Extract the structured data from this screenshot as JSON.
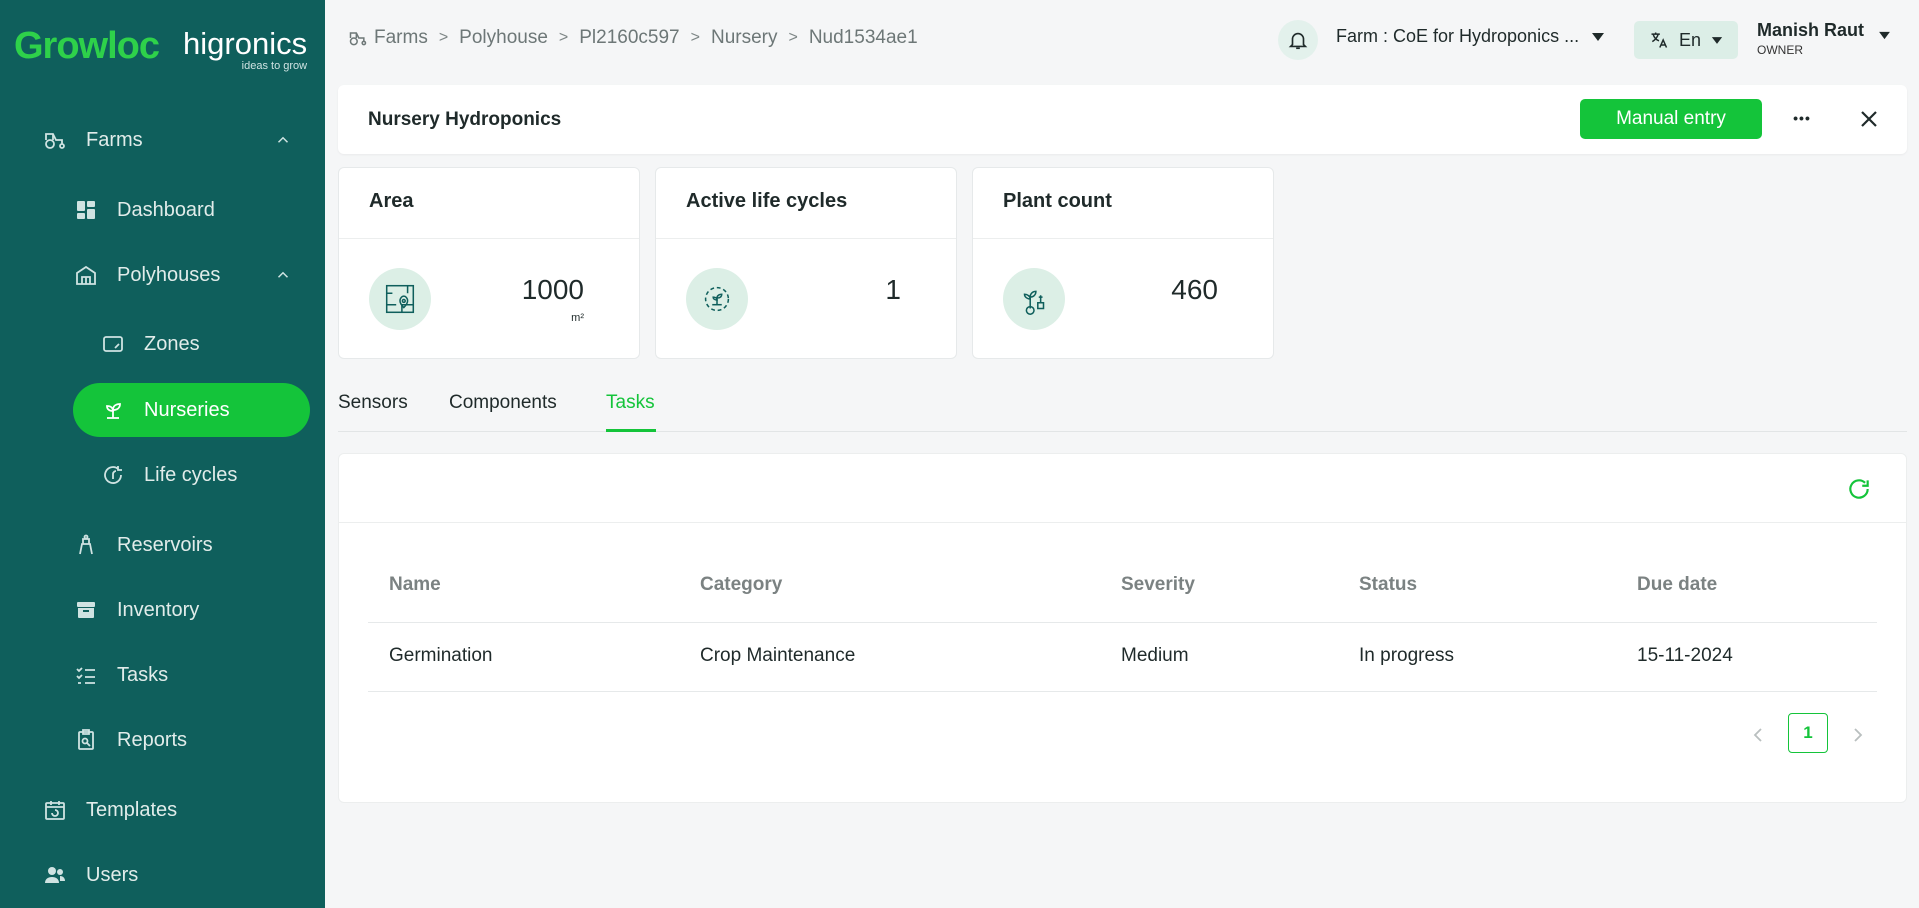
{
  "brand": {
    "logo": "Growloc",
    "partner": "higronics",
    "tagline": "ideas to grow"
  },
  "sidebar": {
    "items": [
      {
        "label": "Farms",
        "icon": "tractor-icon"
      },
      {
        "label": "Dashboard",
        "icon": "dashboard-icon"
      },
      {
        "label": "Polyhouses",
        "icon": "polyhouse-icon"
      },
      {
        "label": "Zones",
        "icon": "zone-icon"
      },
      {
        "label": "Nurseries",
        "icon": "sprout-icon"
      },
      {
        "label": "Life cycles",
        "icon": "cycle-icon"
      },
      {
        "label": "Reservoirs",
        "icon": "reservoir-icon"
      },
      {
        "label": "Inventory",
        "icon": "inventory-icon"
      },
      {
        "label": "Tasks",
        "icon": "tasks-icon"
      },
      {
        "label": "Reports",
        "icon": "reports-icon"
      },
      {
        "label": "Templates",
        "icon": "templates-icon"
      },
      {
        "label": "Users",
        "icon": "users-icon"
      }
    ],
    "active": "Nurseries"
  },
  "breadcrumb": [
    "Farms",
    "Polyhouse",
    "Pl2160c597",
    "Nursery",
    "Nud1534ae1"
  ],
  "topbar": {
    "farm_label": "Farm : CoE for Hydroponics ...",
    "language": "En",
    "user_name": "Manish Raut",
    "user_role": "OWNER"
  },
  "header": {
    "title": "Nursery Hydroponics",
    "manual_entry_label": "Manual entry",
    "more_label": "•••"
  },
  "stats": {
    "area": {
      "title": "Area",
      "value": "1000",
      "unit": "m²"
    },
    "active_life_cycles": {
      "title": "Active life cycles",
      "value": "1"
    },
    "plant_count": {
      "title": "Plant count",
      "value": "460"
    }
  },
  "tabs": [
    {
      "label": "Sensors"
    },
    {
      "label": "Components"
    },
    {
      "label": "Tasks"
    }
  ],
  "active_tab": "Tasks",
  "table": {
    "columns": [
      "Name",
      "Category",
      "Severity",
      "Status",
      "Due date"
    ],
    "rows": [
      [
        "Germination",
        "Crop Maintenance",
        "Medium",
        "In progress",
        "15-11-2024"
      ]
    ]
  },
  "pagination": {
    "current": "1"
  },
  "colors": {
    "sidebar": "#0f5f5c",
    "accent": "#14c43a"
  }
}
